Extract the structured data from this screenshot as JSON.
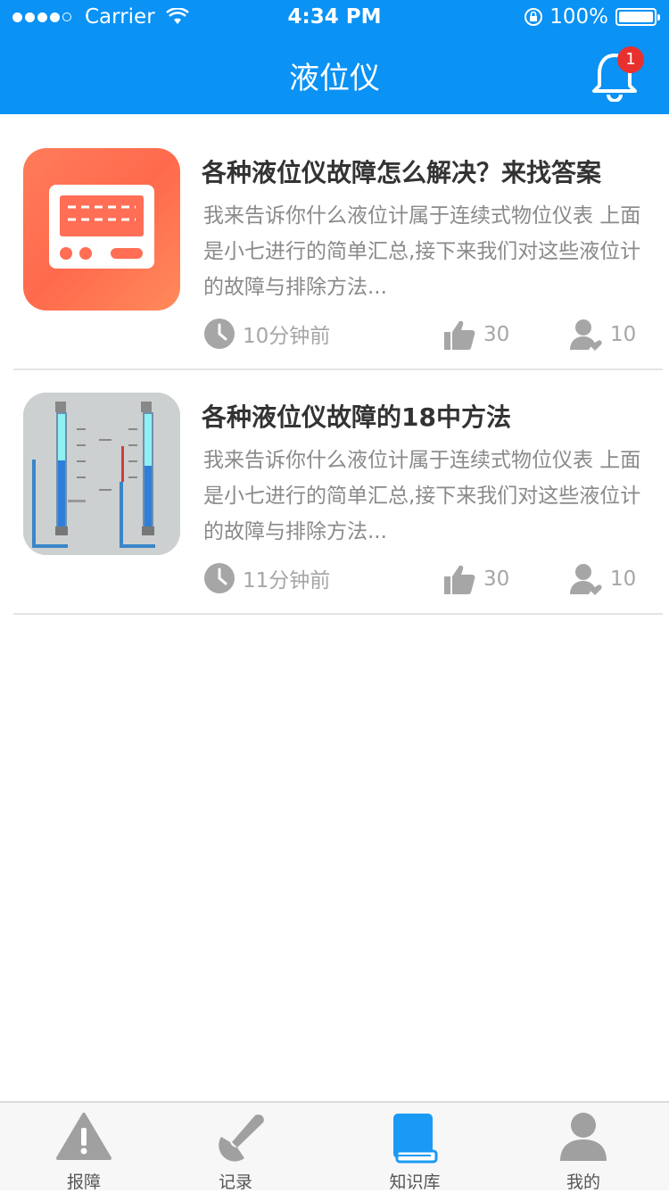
{
  "status_bar": {
    "carrier": "Carrier",
    "time": "4:34 PM",
    "battery": "100%"
  },
  "header": {
    "title": "液位仪",
    "notification_count": "1"
  },
  "articles": [
    {
      "title": "各种液位仪故障怎么解决？来找答案",
      "summary": "我来告诉你什么液位计属于连续式物位仪表 上面是小七进行的简单汇总,接下来我们对这些液位计的故障与排除方法...",
      "time": "10分钟前",
      "likes": "30",
      "followers": "10"
    },
    {
      "title": "各种液位仪故障的18中方法",
      "summary": "我来告诉你什么液位计属于连续式物位仪表 上面是小七进行的简单汇总,接下来我们对这些液位计的故障与排除方法...",
      "time": "11分钟前",
      "likes": "30",
      "followers": "10"
    }
  ],
  "tabs": [
    {
      "label": "报障",
      "icon": "warning-icon",
      "active": false
    },
    {
      "label": "记录",
      "icon": "wrench-icon",
      "active": false
    },
    {
      "label": "知识库",
      "icon": "book-icon",
      "active": true
    },
    {
      "label": "我的",
      "icon": "user-icon",
      "active": false
    }
  ],
  "colors": {
    "primary": "#0a92f5",
    "badge": "#e8312e",
    "inactive": "#a0a0a0",
    "active": "#1a9af5"
  }
}
